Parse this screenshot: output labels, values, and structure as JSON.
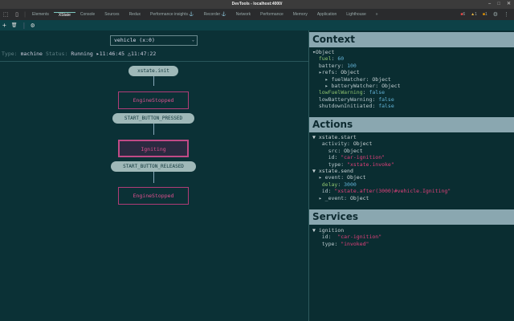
{
  "window": {
    "title": "DevTools - localhost:4000/"
  },
  "tabs": [
    "Elements",
    "XState",
    "Console",
    "Sources",
    "Redux",
    "Performance insights ⚓",
    "Recorder ⚓",
    "Network",
    "Performance",
    "Memory",
    "Application",
    "Lighthouse",
    "»"
  ],
  "active_tab": "XState",
  "tab_badges": {
    "errors": "6",
    "warnings": "1",
    "info": "1"
  },
  "toolbar": {
    "add": "+",
    "delete": "🗑",
    "settings": "⚙"
  },
  "machine_select": {
    "value": "vehicle (x:0)"
  },
  "status_bar": {
    "type_label": "Type:",
    "type_value": "machine",
    "status_label": "Status:",
    "status_value": "Running",
    "start_time": "▸11:46:45",
    "update_time": "△11:47:22"
  },
  "graph": {
    "init": "xstate.init",
    "states": [
      "EngineStopped",
      "Igniting",
      "EngineStopped"
    ],
    "events": [
      "START_BUTTON_PRESSED",
      "START_BUTTON_RELEASED"
    ]
  },
  "context": {
    "title": "Context",
    "lines": [
      [
        [
          "o",
          "▾Object"
        ]
      ],
      [
        [
          "k",
          "  fuel"
        ],
        [
          "o",
          ": "
        ],
        [
          "n",
          "60"
        ]
      ],
      [
        [
          "kb",
          "  battery"
        ],
        [
          "o",
          ": "
        ],
        [
          "n",
          "100"
        ]
      ],
      [
        [
          "kb",
          "  ▸refs"
        ],
        [
          "o",
          ": Object"
        ]
      ],
      [
        [
          "kb",
          "    ▸ fuelWatcher"
        ],
        [
          "o",
          ": Object"
        ]
      ],
      [
        [
          "kb",
          "    ▸ batteryWatcher"
        ],
        [
          "o",
          ": Object"
        ]
      ],
      [
        [
          "k",
          "  lowFuelWarning"
        ],
        [
          "o",
          ": "
        ],
        [
          "n",
          "false"
        ]
      ],
      [
        [
          "kb",
          "  lowBatteryWarning"
        ],
        [
          "o",
          ": "
        ],
        [
          "n",
          "false"
        ]
      ],
      [
        [
          "kb",
          "  shutdownInitiated"
        ],
        [
          "o",
          ": "
        ],
        [
          "n",
          "false"
        ]
      ]
    ]
  },
  "actions": {
    "title": "Actions",
    "lines": [
      [
        [
          "o",
          "▼ xstate.start"
        ]
      ],
      [
        [
          "kb",
          "   activity"
        ],
        [
          "o",
          ": Object"
        ]
      ],
      [
        [
          "kb",
          "     src"
        ],
        [
          "o",
          ": Object"
        ]
      ],
      [
        [
          "kb",
          "     id"
        ],
        [
          "o",
          ": "
        ],
        [
          "s",
          "\"car-ignition\""
        ]
      ],
      [
        [
          "kb",
          "     type"
        ],
        [
          "o",
          ": "
        ],
        [
          "s",
          "\"xstate.invoke\""
        ]
      ],
      [
        [
          "o",
          "▼ xstate.send"
        ]
      ],
      [
        [
          "kb",
          "  ▸ event"
        ],
        [
          "o",
          ": Object"
        ]
      ],
      [
        [
          "k",
          "   delay"
        ],
        [
          "o",
          ": "
        ],
        [
          "n",
          "3000"
        ]
      ],
      [
        [
          "kb",
          "   id"
        ],
        [
          "o",
          ": "
        ],
        [
          "s",
          "\"xstate.after(3000)#vehicle.Igniting\""
        ]
      ],
      [
        [
          "kb",
          "  ▸ _event"
        ],
        [
          "o",
          ": Object"
        ]
      ]
    ]
  },
  "services": {
    "title": "Services",
    "lines": [
      [
        [
          "o",
          "▼ ignition"
        ]
      ],
      [
        [
          "kb",
          "   id"
        ],
        [
          "o",
          ":  "
        ],
        [
          "s",
          "\"car-ignition\""
        ]
      ],
      [
        [
          "kb",
          "   type"
        ],
        [
          "o",
          ": "
        ],
        [
          "s",
          "\"invoked\""
        ]
      ]
    ]
  }
}
